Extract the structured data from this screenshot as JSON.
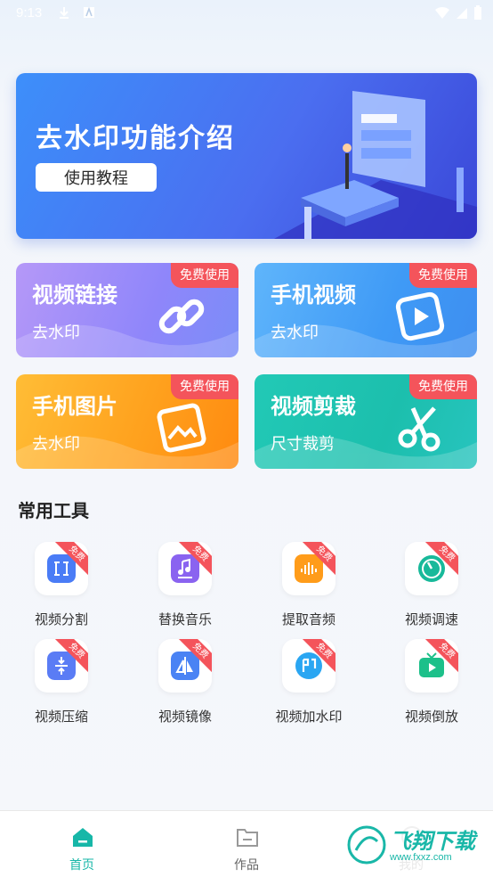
{
  "status_bar": {
    "time": "9:13",
    "icons": [
      "download-icon",
      "notification-a-icon",
      "wifi-icon",
      "signal-icon",
      "battery-icon"
    ]
  },
  "banner": {
    "title": "去水印功能介绍",
    "button_label": "使用教程"
  },
  "feature_cards": [
    {
      "title": "视频链接",
      "subtitle": "去水印",
      "tag": "免费使用",
      "icon": "link-icon"
    },
    {
      "title": "手机视频",
      "subtitle": "去水印",
      "tag": "免费使用",
      "icon": "play-icon"
    },
    {
      "title": "手机图片",
      "subtitle": "去水印",
      "tag": "免费使用",
      "icon": "image-icon"
    },
    {
      "title": "视频剪裁",
      "subtitle": "尺寸裁剪",
      "tag": "免费使用",
      "icon": "scissors-icon"
    }
  ],
  "tools_section": {
    "title": "常用工具",
    "ribbon": "免费",
    "items": [
      {
        "label": "视频分割",
        "icon": "split-icon",
        "color": "#4a7cf6"
      },
      {
        "label": "替换音乐",
        "icon": "music-icon",
        "color": "#8a63f0"
      },
      {
        "label": "提取音频",
        "icon": "audio-icon",
        "color": "#ff9c1a"
      },
      {
        "label": "视频调速",
        "icon": "speed-icon",
        "color": "#18b99a"
      },
      {
        "label": "视频压缩",
        "icon": "compress-icon",
        "color": "#5a7cf5"
      },
      {
        "label": "视频镜像",
        "icon": "mirror-icon",
        "color": "#4a83f4"
      },
      {
        "label": "视频加水印",
        "icon": "watermark-icon",
        "color": "#2aa6f2"
      },
      {
        "label": "视频倒放",
        "icon": "reverse-play-icon",
        "color": "#1dc08a"
      }
    ]
  },
  "bottom_nav": {
    "items": [
      {
        "label": "首页",
        "icon": "home-icon",
        "active": true
      },
      {
        "label": "作品",
        "icon": "folder-icon",
        "active": false
      },
      {
        "label": "我的",
        "icon": "user-icon",
        "active": false
      }
    ]
  },
  "watermark": {
    "text": "飞翔下载",
    "url": "www.fxxz.com"
  },
  "colors": {
    "accent": "#17b7a8",
    "tag_red": "#f4545b"
  }
}
